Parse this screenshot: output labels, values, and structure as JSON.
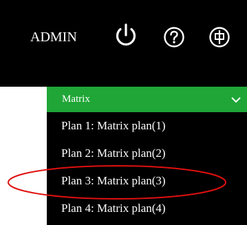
{
  "header": {
    "user_label": "ADMIN",
    "icons": [
      "power-icon",
      "help-icon",
      "language-icon"
    ]
  },
  "dropdown": {
    "title": "Matrix",
    "items": [
      {
        "label": "Plan 1: Matrix plan(1)"
      },
      {
        "label": "Plan 2: Matrix plan(2)"
      },
      {
        "label": "Plan 3: Matrix plan(3)"
      },
      {
        "label": "Plan 4: Matrix plan(4)"
      }
    ],
    "highlighted_item": "Plan 3: Matrix plan(3)"
  },
  "colors": {
    "bar_background": "#000000",
    "dropdown_header": "#1fa637",
    "text": "#ffffff",
    "annotation_circle": "#e01010"
  }
}
